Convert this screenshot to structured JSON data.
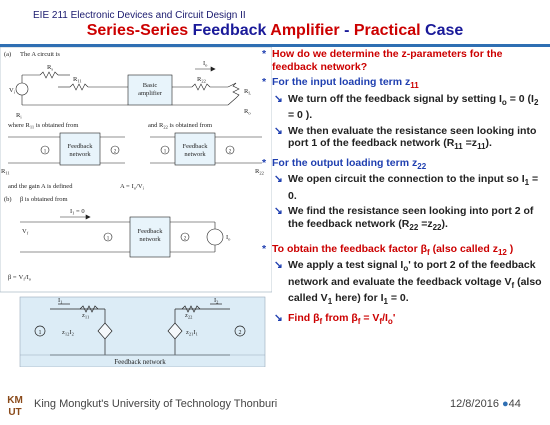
{
  "header": {
    "course": "EIE 211 Electronic Devices and Circuit Design II",
    "title_part1": "Series-Series",
    "title_part2": "Feedback",
    "title_part3": "Amplifier",
    "title_sep": "-",
    "title_part4": "Practical",
    "title_part5": "Case"
  },
  "diagram": {
    "a_label": "(a)",
    "a_text": "The A circuit is",
    "basic_amplifier": "Basic",
    "basic_amplifier2": "amplifier",
    "R11_note": "where R",
    "R11_note2": " is obtained from",
    "R22_note": "and R",
    "R22_note2": " is obtained from",
    "feedback_network": "Feedback",
    "feedback_network2": "network",
    "gain_note": "and the gain A is defined",
    "gain_eq": "A =",
    "b_label": "(b)",
    "b_text": "β is obtained from",
    "i1_zero": "I",
    "i1_zero2": " = 0",
    "beta_eq": "β =",
    "port1": "1",
    "port2": "2",
    "zparam_block": "Feedback network",
    "z11": "z",
    "z22": "z",
    "z12I2": "z",
    "z21I1": "z"
  },
  "bullets": {
    "q1": "How do we determine the z-parameters for the feedback network?",
    "input_head": "For the input loading term z",
    "input_head_sub": "11",
    "input_1a": "We turn off the feedback signal by setting I",
    "input_1b": "o",
    "input_1c": " = 0 (I",
    "input_1d": "2",
    "input_1e": " = 0 ).",
    "input_2a": "We then evaluate the resistance seen looking into port 1 of the feedback network (R",
    "input_2b": "11",
    "input_2c": " =z",
    "input_2d": "11",
    "input_2e": ").",
    "output_head": "For the output loading term z",
    "output_head_sub": "22",
    "output_1a": "We open circuit the connection to the input so I",
    "output_1b": "1",
    "output_1c": " = 0.",
    "output_2a": "We find the resistance seen looking into port 2 of the feedback network (R",
    "output_2b": "22",
    "output_2c": " =z",
    "output_2d": "22",
    "output_2e": ").",
    "beta_head_a": "To obtain the feedback factor ",
    "beta_head_b": "β",
    "beta_head_c": "f",
    "beta_head_d": " (also called z",
    "beta_head_e": "12",
    "beta_head_f": " )",
    "beta_1a": "We apply a test signal I",
    "beta_1b": "o",
    "beta_1c": "' to port 2 of the feedback network and evaluate the feedback voltage V",
    "beta_1d": "f",
    "beta_1e": " (also called V",
    "beta_1f": "1",
    "beta_1g": " here) for I",
    "beta_1h": "1",
    "beta_1i": " = 0.",
    "beta_2a": "Find β",
    "beta_2b": "f",
    "beta_2c": " from β",
    "beta_2d": "f",
    "beta_2e": " = V",
    "beta_2f": "f",
    "beta_2g": "/I",
    "beta_2h": "o",
    "beta_2i": "'"
  },
  "footer": {
    "logo_text": "KM",
    "logo_text2": "UT",
    "university": "King Mongkut's University of Technology Thonburi",
    "date": "12/8/2016",
    "dot": "●",
    "page": "44"
  },
  "colors": {
    "title_red": "#cc0000",
    "title_blue": "#1a1a99",
    "bullet_blue": "#1f3fb0",
    "bar_blue": "#2f6fb3"
  },
  "icons": {
    "bullet": "star-bullet-icon",
    "sub_bullet": "arrow-bullet-icon"
  }
}
